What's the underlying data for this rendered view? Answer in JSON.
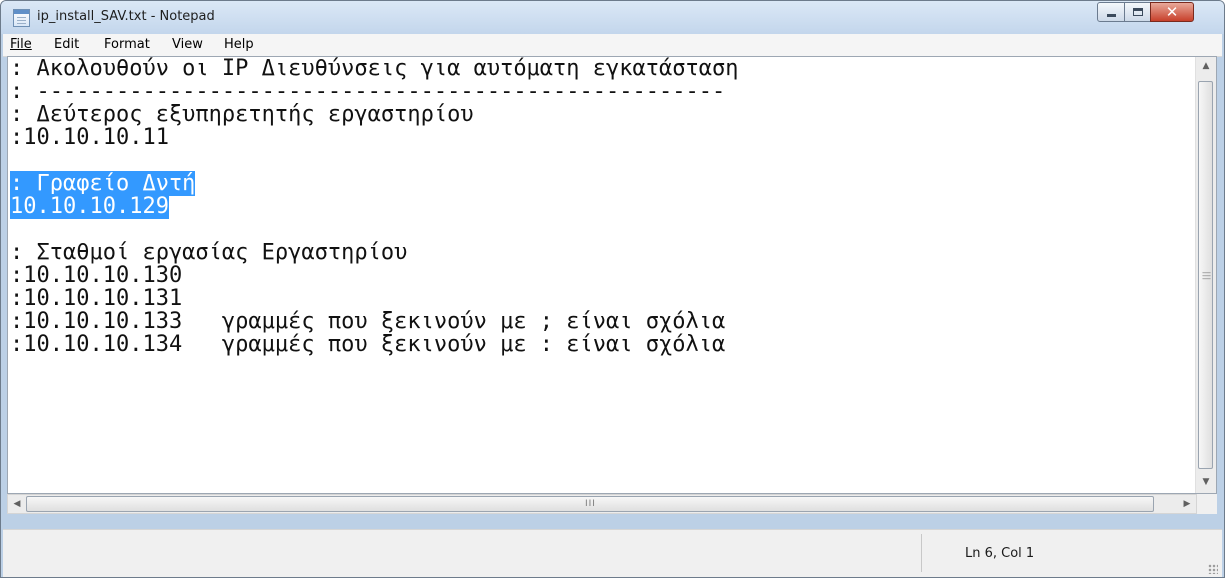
{
  "window": {
    "title": "ip_install_SAV.txt - Notepad",
    "close_glyph": "✕"
  },
  "menu": [
    {
      "label": "File"
    },
    {
      "label": "Edit"
    },
    {
      "label": "Format"
    },
    {
      "label": "View"
    },
    {
      "label": "Help"
    }
  ],
  "editor": {
    "lines": [
      ": Ακολουθούν οι IP Διευθύνσεις για αυτόματη εγκατάσταση",
      ": ----------------------------------------------------",
      ": Δεύτερος εξυπηρετητής εργαστηρίου",
      ":10.10.10.11",
      "",
      ": Γραφείο Δντή",
      "10.10.10.129",
      "",
      ": Σταθμοί εργασίας Εργαστηρίου",
      ":10.10.10.130",
      ":10.10.10.131",
      ":10.10.10.133   γραμμές που ξεκινούν με ; είναι σχόλια",
      ":10.10.10.134   γραμμές που ξεκινούν με : είναι σχόλια"
    ],
    "selected_lines": [
      5,
      6
    ]
  },
  "scrollbars": {
    "up_arrow": "▲",
    "down_arrow": "▼",
    "left_arrow": "◀",
    "right_arrow": "▶",
    "h_grip": "III"
  },
  "status": {
    "position": "Ln 6, Col 1"
  },
  "colors": {
    "selection": "#3399ff",
    "titlebar": "#c3d6ec",
    "close_button": "#c7402b"
  },
  "icons": {
    "app": "notepad-icon",
    "minimize": "minimize-icon",
    "maximize": "maximize-icon",
    "close": "close-icon"
  }
}
